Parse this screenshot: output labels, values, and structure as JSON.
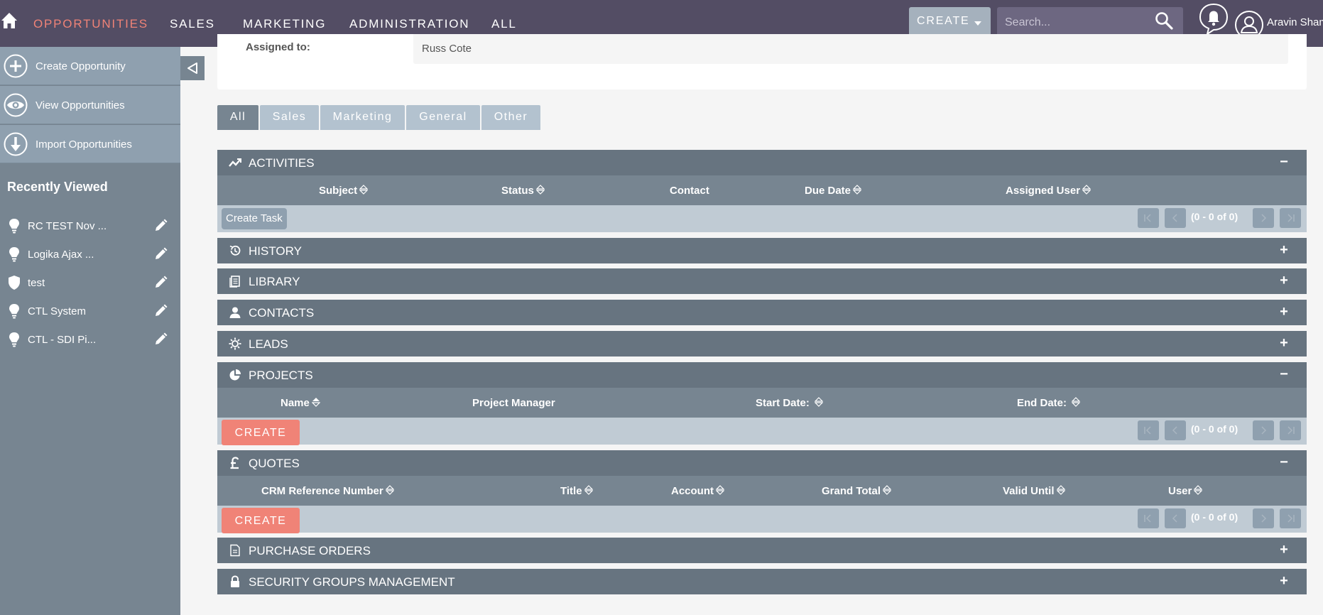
{
  "nav": {
    "items": [
      "OPPORTUNITIES",
      "SALES",
      "MARKETING",
      "ADMINISTRATION",
      "ALL"
    ],
    "create_label": "CREATE",
    "search_placeholder": "Search...",
    "username": "Aravin Sham",
    "active_color": "#f08377",
    "bar_color": "#534d64"
  },
  "sidebar": {
    "actions": [
      {
        "label": "Create Opportunity",
        "icon": "plus-circle-icon"
      },
      {
        "label": "View Opportunities",
        "icon": "eye-icon"
      },
      {
        "label": "Import Opportunities",
        "icon": "download-circle-icon"
      }
    ],
    "recent_title": "Recently Viewed",
    "recent": [
      {
        "label": "RC TEST Nov ...",
        "icon": "lightbulb-icon"
      },
      {
        "label": "Logika Ajax ...",
        "icon": "lightbulb-icon"
      },
      {
        "label": "test",
        "icon": "shield-icon"
      },
      {
        "label": "CTL System",
        "icon": "lightbulb-icon"
      },
      {
        "label": "CTL - SDI Pi...",
        "icon": "lightbulb-icon"
      }
    ]
  },
  "detail": {
    "label": "Assigned to:",
    "value": "Russ Cote"
  },
  "tabs": [
    "All",
    "Sales",
    "Marketing",
    "General",
    "Other"
  ],
  "panels": {
    "activities": {
      "title": "ACTIVITIES",
      "toggle": "−",
      "columns": [
        "Subject",
        "Status",
        "Contact",
        "Due Date",
        "Assigned User"
      ],
      "button": "Create Task",
      "pager": "(0 - 0 of 0)"
    },
    "history": {
      "title": "HISTORY",
      "toggle": "+"
    },
    "library": {
      "title": "LIBRARY",
      "toggle": "+"
    },
    "contacts": {
      "title": "CONTACTS",
      "toggle": "+"
    },
    "leads": {
      "title": "LEADS",
      "toggle": "+"
    },
    "projects": {
      "title": "PROJECTS",
      "toggle": "−",
      "columns": [
        "Name",
        "Project Manager",
        "Start Date:",
        "End Date:"
      ],
      "button": "CREATE",
      "pager": "(0 - 0 of 0)"
    },
    "quotes": {
      "title": "QUOTES",
      "toggle": "−",
      "columns": [
        "CRM Reference Number",
        "Title",
        "Account",
        "Grand Total",
        "Valid Until",
        "User"
      ],
      "button": "CREATE",
      "pager": "(0 - 0 of 0)"
    },
    "purchase_orders": {
      "title": "PURCHASE ORDERS",
      "toggle": "+"
    },
    "security_groups": {
      "title": "SECURITY GROUPS MANAGEMENT",
      "toggle": "+"
    }
  }
}
